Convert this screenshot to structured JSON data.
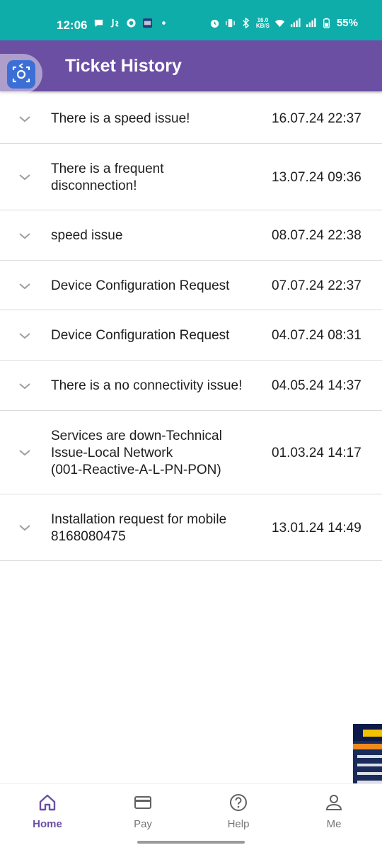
{
  "status_bar": {
    "time": "12:06",
    "network_speed": "16.0",
    "network_speed_unit": "KB/S",
    "battery": "55%",
    "background_color": "#0fada9"
  },
  "app_bar": {
    "title": "Ticket History",
    "background_color": "#6b4fa3"
  },
  "tickets": [
    {
      "subject": "There is a speed issue!",
      "date": "16.07.24 22:37"
    },
    {
      "subject": "There is a frequent\ndisconnection!",
      "date": "13.07.24 09:36"
    },
    {
      "subject": "speed issue",
      "date": "08.07.24 22:38"
    },
    {
      "subject": "Device Configuration Request",
      "date": "07.07.24 22:37"
    },
    {
      "subject": "Device Configuration Request",
      "date": "04.07.24 08:31"
    },
    {
      "subject": "There is a no connectivity issue!",
      "date": "04.05.24 14:37"
    },
    {
      "subject": "Services are down-Technical\nIssue-Local Network\n(001-Reactive-A-L-PN-PON)",
      "date": "01.03.24 14:17"
    },
    {
      "subject": "Installation request for mobile\n8168080475",
      "date": "13.01.24 14:49"
    }
  ],
  "bottom_nav": {
    "items": [
      {
        "label": "Home",
        "icon": "home-icon",
        "active": true
      },
      {
        "label": "Pay",
        "icon": "card-icon",
        "active": false
      },
      {
        "label": "Help",
        "icon": "help-icon",
        "active": false
      },
      {
        "label": "Me",
        "icon": "person-icon",
        "active": false
      }
    ],
    "active_color": "#6b4fa3"
  }
}
